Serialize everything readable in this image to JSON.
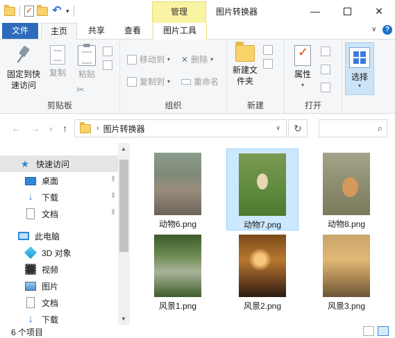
{
  "window": {
    "title": "图片转换器",
    "context_tab": "管理",
    "help": "?"
  },
  "ribbon_tabs": {
    "file": "文件",
    "home": "主页",
    "share": "共享",
    "view": "查看",
    "picture_tools": "图片工具"
  },
  "ribbon": {
    "clipboard": {
      "label": "剪贴板",
      "pin": "固定到快速访问",
      "copy": "复制",
      "paste": "粘贴"
    },
    "organize": {
      "label": "组织",
      "move_to": "移动到",
      "copy_to": "复制到",
      "delete": "删除",
      "rename": "重命名"
    },
    "new": {
      "label": "新建",
      "new_folder": "新建文件夹"
    },
    "open": {
      "label": "打开",
      "properties": "属性"
    },
    "select": {
      "select": "选择"
    }
  },
  "address": {
    "path": "图片转换器"
  },
  "nav": {
    "quick_access": "快速访问",
    "desktop": "桌面",
    "downloads": "下载",
    "documents": "文档",
    "this_pc": "此电脑",
    "objects_3d": "3D 对象",
    "videos": "视频",
    "pictures": "图片",
    "documents2": "文档",
    "downloads2": "下载"
  },
  "files": [
    {
      "name": "动物6.png"
    },
    {
      "name": "动物7.png"
    },
    {
      "name": "动物8.png"
    },
    {
      "name": "风景1.png"
    },
    {
      "name": "风景2.png"
    },
    {
      "name": "风景3.png"
    }
  ],
  "status": {
    "count": "6 个项目"
  },
  "colors": {
    "file_tab": "#2f6bbd",
    "context_tab": "#f9f3a4",
    "selection": "#cce8ff",
    "accent": "#2f86d6"
  }
}
